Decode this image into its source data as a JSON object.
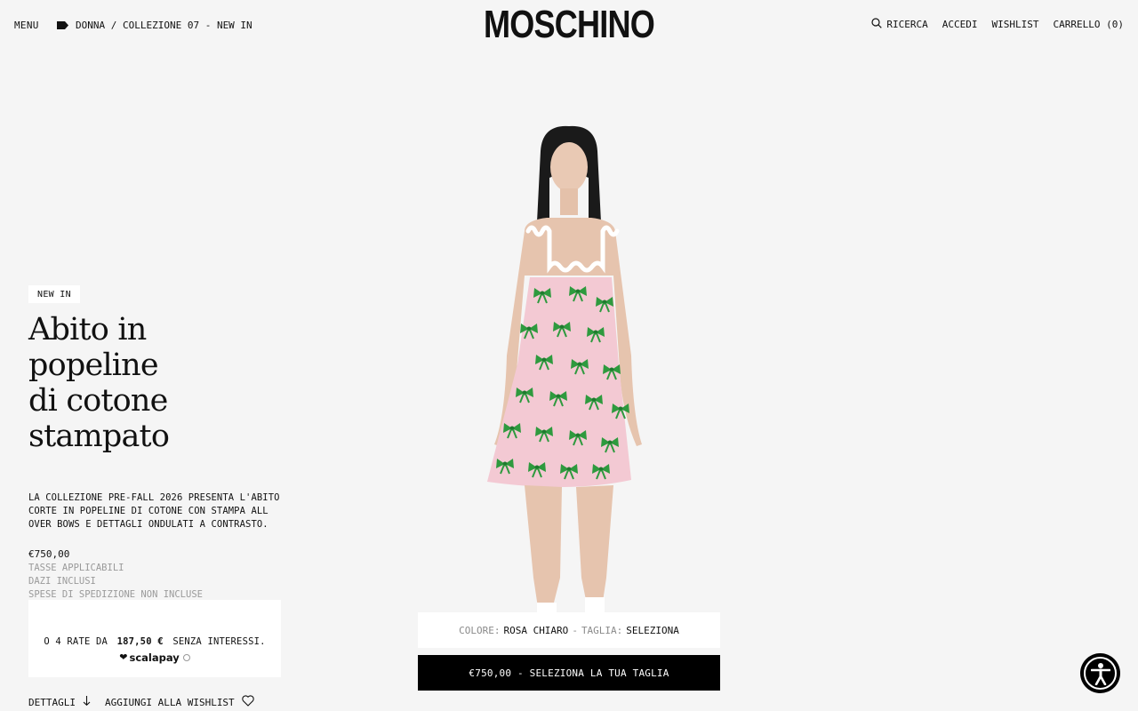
{
  "header": {
    "menu_label": "MENU",
    "breadcrumb_text": "DONNA / COLLEZIONE 07 - NEW IN",
    "brand": "MOSCHINO",
    "search_label": "RICERCA",
    "login_label": "ACCEDI",
    "wishlist_label": "WISHLIST",
    "cart_label": "CARRELLO (0)"
  },
  "product": {
    "badge": "NEW IN",
    "title_lines": [
      "Abito in popeline",
      "di cotone",
      "stampato"
    ],
    "description": "LA COLLEZIONE PRE-FALL 2026 PRESENTA L'ABITO CORTE IN POPELINE DI COTONE CON STAMPA ALL OVER BOWS E DETTAGLI ONDULATI A CONTRASTO.",
    "price": "€750,00",
    "tax_notes": [
      "TASSE APPLICABILI",
      "DAZI INCLUSI",
      "SPESE DI SPEDIZIONE NON INCLUSE"
    ]
  },
  "scalapay": {
    "prefix": "O 4 RATE DA",
    "amount": "187,50 €",
    "suffix": "SENZA INTERESSI.",
    "brand": "scalapay"
  },
  "links": {
    "details": "DETTAGLI",
    "add_wishlist": "AGGIUNGI ALLA WISHLIST"
  },
  "selection": {
    "color_label": "COLORE:",
    "color_value": "ROSA CHIARO",
    "separator": "-",
    "size_label": "TAGLIA:",
    "size_value": "SELEZIONA"
  },
  "cta": {
    "label": "€750,00 - SELEZIONA LA TUA TAGLIA"
  },
  "colors": {
    "background": "#f5f5f5",
    "dress_pink": "#f3c9d3",
    "bow_green": "#2e9a3e",
    "cta_bg": "#000000"
  }
}
